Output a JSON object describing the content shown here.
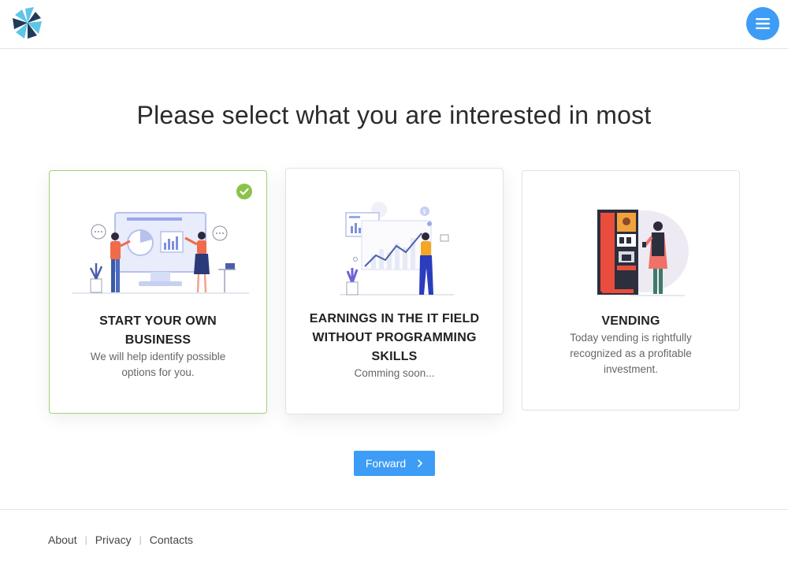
{
  "header": {
    "logo_icon": "pinwheel-logo-icon",
    "menu_icon": "hamburger-menu-icon",
    "accent_color": "#3d9cf5"
  },
  "main": {
    "title": "Please select what you are interested in most",
    "cards": [
      {
        "title_line1": "START YOUR OWN",
        "title_line2": "BUSINESS",
        "desc_line1": "We will help identify possible",
        "desc_line2": "options for you.",
        "selected": true,
        "illustration": "business-presentation-illustration"
      },
      {
        "title_line1": "EARNINGS IN THE IT FIELD",
        "title_line2": "WITHOUT PROGRAMMING",
        "title_line3": "SKILLS",
        "desc_line1": "Comming soon...",
        "selected": false,
        "illustration": "analytics-chart-illustration"
      },
      {
        "title_line1": "VENDING",
        "desc_line1": "Today vending is rightfully",
        "desc_line2": "recognized as a profitable",
        "desc_line3": "investment.",
        "selected": false,
        "illustration": "vending-machine-illustration"
      }
    ],
    "selected_check_color": "#8bc34a",
    "forward_label": "Forward",
    "forward_icon": "chevron-right-icon"
  },
  "footer": {
    "links": [
      "About",
      "Privacy",
      "Contacts"
    ],
    "separator": "|"
  }
}
